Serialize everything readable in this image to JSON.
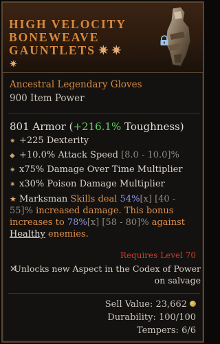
{
  "item": {
    "name_line1": "High Velocity",
    "name_line2": "Boneweave",
    "name_line3": "Gauntlets",
    "name_stars_inline": "✷ ✷",
    "name_star_line4": "✷",
    "subtype": "Ancestral Legendary Gloves",
    "item_power": "900 Item Power"
  },
  "armor": {
    "prefix": "801 Armor (",
    "toughness_value": "+216.1%",
    "suffix": " Toughness)"
  },
  "stats": [
    {
      "text": "+225 Dexterity",
      "range": ""
    },
    {
      "text": "+10.0% Attack Speed ",
      "range": "[8.0 - 10.0]%"
    },
    {
      "text": "x75% Damage Over Time Multiplier",
      "range": ""
    },
    {
      "text": "x30% Poison Damage Multiplier",
      "range": ""
    }
  ],
  "aspect": {
    "part1": "Marksman ",
    "part2": "Skills deal ",
    "val1": "54%",
    "mark1": "[x]",
    "range1": " [40 - 55]%",
    "part3": " increased damage. This bonus increases to ",
    "val2": "78%",
    "mark2": "[x]",
    "range2": " [58 - 80]%",
    "part4": " against ",
    "healthy": "Healthy",
    "part5": " enemies."
  },
  "requires": "Requires Level 70",
  "unlock_icon": "✕",
  "unlock_line1": "Unlocks new Aspect in the Codex of Power",
  "unlock_line2": "on salvage",
  "sell_value": "Sell Value: 23,662",
  "durability": "Durability: 100/100",
  "tempers": "Tempers: 6/6",
  "colors": {
    "legendary_orange": "#d98a3e",
    "toughness_green": "#5fd15f",
    "value_blue": "#8e96e8",
    "requirement_red": "#c83c2a"
  },
  "icons": {
    "item": "gauntlet-icon",
    "lock": "lock-icon",
    "coin": "gold-coin-icon"
  }
}
